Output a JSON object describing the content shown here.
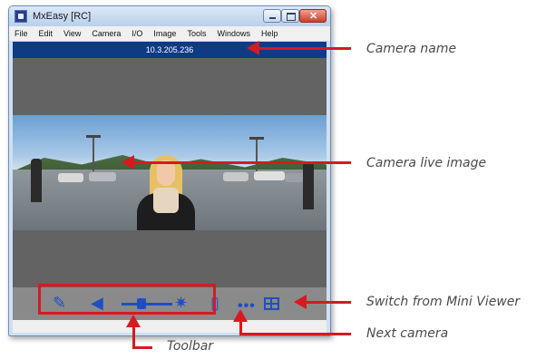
{
  "window": {
    "title": "MxEasy [RC]"
  },
  "menu": [
    "File",
    "Edit",
    "View",
    "Camera",
    "I/O",
    "Image",
    "Tools",
    "Windows",
    "Help"
  ],
  "camera_name_bar": "10.3.205.236",
  "toolbar_icons": [
    "microphone-icon",
    "speaker-icon",
    "zoom-slider",
    "light-icon",
    "door-icon"
  ],
  "annotations": {
    "camera_name": "Camera name",
    "camera_live_image": "Camera live image",
    "switch_from_mini_viewer": "Switch from Mini Viewer",
    "next_camera": "Next camera",
    "toolbar": "Toolbar"
  },
  "colors": {
    "accent": "#1e4fc2",
    "annotation_red": "#d71920",
    "camera_bar": "#0f3a86"
  }
}
